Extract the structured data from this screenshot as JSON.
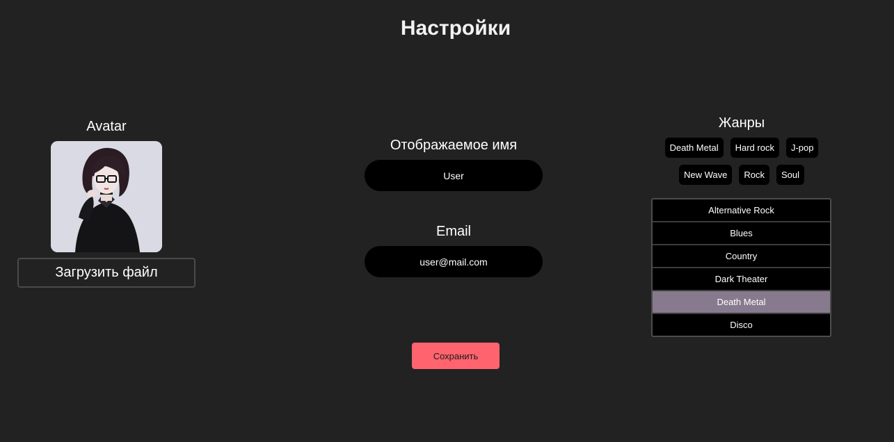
{
  "page": {
    "title": "Настройки"
  },
  "avatar": {
    "label": "Avatar",
    "upload_label": "Загрузить файл",
    "image_description_icon": "avatar-image"
  },
  "profile": {
    "display_name_label": "Отображаемое имя",
    "display_name_value": "User",
    "email_label": "Email",
    "email_value": "user@mail.com",
    "save_label": "Сохранить"
  },
  "genres": {
    "label": "Жанры",
    "selected_chips_row1": [
      "Death Metal",
      "Hard rock",
      "J-pop"
    ],
    "selected_chips_row2": [
      "New Wave",
      "Rock",
      "Soul"
    ],
    "list": [
      "Alternative Rock",
      "Blues",
      "Country",
      "Dark Theater",
      "Death Metal",
      "Disco"
    ],
    "highlighted": "Death Metal"
  },
  "colors": {
    "background": "#222222",
    "save_button": "#ff646e",
    "selected_item": "#877a8e",
    "input_bg": "#000000"
  }
}
